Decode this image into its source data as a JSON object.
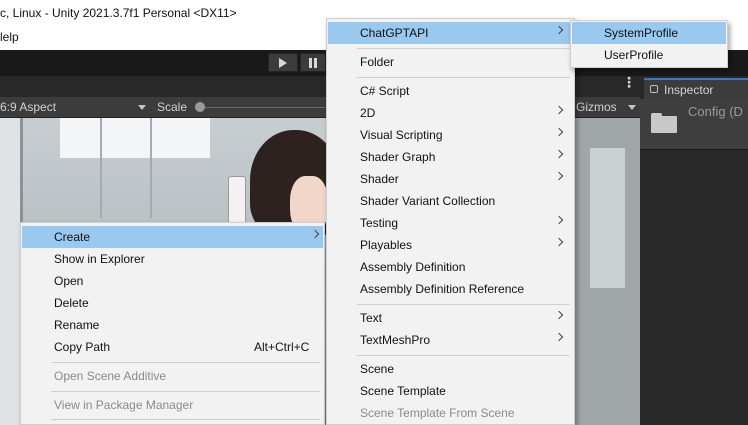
{
  "window": {
    "title": "c, Linux - Unity 2021.3.7f1 Personal <DX11>"
  },
  "menubar": {
    "help": "lelp"
  },
  "game_view": {
    "aspect": "6:9 Aspect",
    "scale_label": "Scale",
    "gizmos": "Gizmos"
  },
  "inspector": {
    "tab": "Inspector",
    "object_name": "Config (D"
  },
  "context_menu": {
    "items": [
      {
        "label": "Create",
        "submenu": true,
        "highlighted": true
      },
      {
        "label": "Show in Explorer"
      },
      {
        "label": "Open"
      },
      {
        "label": "Delete"
      },
      {
        "label": "Rename"
      },
      {
        "label": "Copy Path",
        "shortcut": "Alt+Ctrl+C"
      },
      {
        "label": "Open Scene Additive",
        "disabled": true
      },
      {
        "label": "View in Package Manager",
        "disabled": true
      }
    ]
  },
  "create_menu": {
    "items": [
      {
        "label": "ChatGPTAPI",
        "submenu": true,
        "highlighted": true
      },
      {
        "label": "Folder"
      },
      {
        "label": "C# Script"
      },
      {
        "label": "2D",
        "submenu": true
      },
      {
        "label": "Visual Scripting",
        "submenu": true
      },
      {
        "label": "Shader Graph",
        "submenu": true
      },
      {
        "label": "Shader",
        "submenu": true
      },
      {
        "label": "Shader Variant Collection"
      },
      {
        "label": "Testing",
        "submenu": true
      },
      {
        "label": "Playables",
        "submenu": true
      },
      {
        "label": "Assembly Definition"
      },
      {
        "label": "Assembly Definition Reference"
      },
      {
        "label": "Text",
        "submenu": true
      },
      {
        "label": "TextMeshPro",
        "submenu": true
      },
      {
        "label": "Scene"
      },
      {
        "label": "Scene Template"
      },
      {
        "label": "Scene Template From Scene",
        "disabled": true
      }
    ]
  },
  "chatgpt_submenu": {
    "items": [
      {
        "label": "SystemProfile",
        "highlighted": true
      },
      {
        "label": "UserProfile"
      }
    ]
  }
}
